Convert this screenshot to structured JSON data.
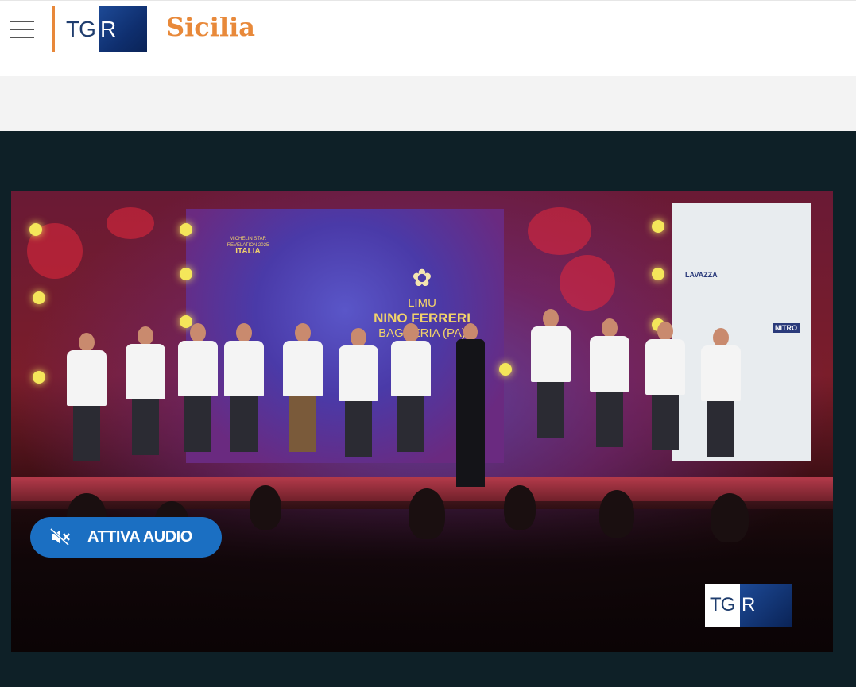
{
  "header": {
    "menu_icon": "hamburger-menu-icon",
    "logo": {
      "tg": "TG",
      "r": "R"
    },
    "region": "Sicilia",
    "accent_color": "#e8893a",
    "brand_blue": "#1b4a97"
  },
  "video": {
    "overlay": {
      "michelin_small": "MICHELIN STAR REVELATION 2025",
      "michelin_country": "ITALIA",
      "restaurant": "LIMU",
      "chef": "NINO FERRERI",
      "location": "BAGHERIA (PA)"
    },
    "audio_button": {
      "label": "ATTIVA AUDIO",
      "icon": "muted-speaker-icon"
    },
    "watermark": {
      "tg": "TG",
      "r": "R"
    },
    "sponsors": [
      "LAVAZZA",
      "NITRO"
    ],
    "button_color": "#1b6fc2"
  }
}
